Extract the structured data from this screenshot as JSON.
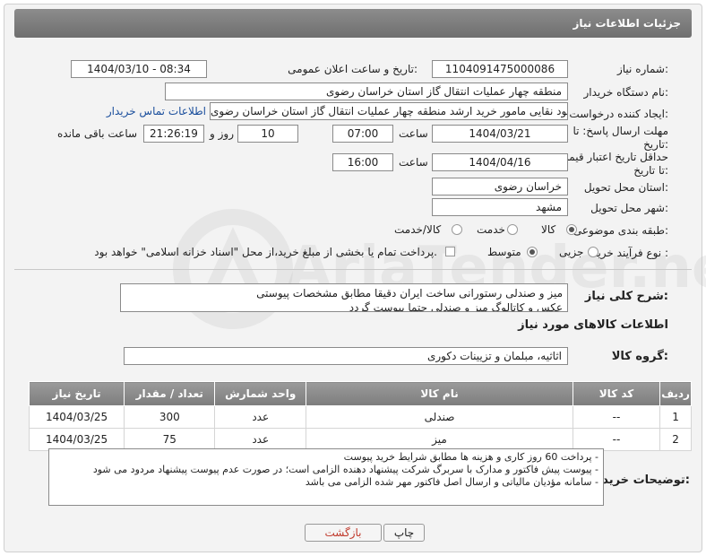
{
  "header": {
    "title": "جزئیات اطلاعات نیاز"
  },
  "fields": {
    "need_number_label": "شماره نیاز:",
    "need_number": "1104091475000086",
    "announce_label": "تاریخ و ساعت اعلان عمومی:",
    "announce_value": "1404/03/10 - 08:34",
    "buyer_org_label": "نام دستگاه خریدار:",
    "buyer_org": "منطقه چهار عملیات انتقال گاز    استان خراسان رضوی",
    "requester_label": "ایجاد کننده درخواست:",
    "requester": "محمود نقایی مامور خرید ارشد منطقه چهار عملیات انتقال گاز    استان خراسان رضوی",
    "contact_link": "اطلاعات تماس خریدار",
    "deadline_label": "مهلت ارسال پاسخ: تا تاریخ:",
    "deadline_date": "1404/03/21",
    "time_label": "ساعت",
    "deadline_time": "07:00",
    "days_value": "10",
    "days_label": "روز و",
    "remaining_time": "21:26:19",
    "remaining_label": "ساعت باقی مانده",
    "validity_label": "حداقل تاریخ اعتبار قیمت: تا تاریخ:",
    "validity_date": "1404/04/16",
    "validity_time": "16:00",
    "province_label": "استان محل تحویل:",
    "province": "خراسان رضوی",
    "city_label": "شهر محل تحویل:",
    "city": "مشهد",
    "category_label": "طبقه بندی موضوعی:",
    "category_options": [
      "کالا",
      "خدمت",
      "کالا/خدمت"
    ],
    "process_label": "نوع فرآیند خرید :",
    "process_options": [
      "جزیی",
      "متوسط"
    ],
    "payment_note": "پرداخت تمام یا بخشی از مبلغ خرید،از محل \"اسناد خزانه اسلامی\" خواهد بود."
  },
  "description": {
    "label": "شرح کلی نیاز:",
    "line1": "میز و صندلی رستورانی ساخت ایران دقیقا مطابق مشخصات پیوستی",
    "line2": "عکس و کاتالوگ میز و صندلی حتما پیوست گردد"
  },
  "goods_section": {
    "title": "اطلاعات کالاهای مورد نیاز",
    "group_label": "گروه کالا:",
    "group_value": "اثاثیه، مبلمان و تزیینات دکوری"
  },
  "table": {
    "headers": [
      "ردیف",
      "کد کالا",
      "نام کالا",
      "واحد شمارش",
      "تعداد / مقدار",
      "تاریخ نیاز"
    ],
    "rows": [
      [
        "1",
        "--",
        "صندلی",
        "عدد",
        "300",
        "1404/03/25"
      ],
      [
        "2",
        "--",
        "میز",
        "عدد",
        "75",
        "1404/03/25"
      ]
    ]
  },
  "buyer_notes": {
    "label": "توضیحات خریدار:",
    "line1": "- پرداخت 60 روز کاری و هزینه ها مطابق شرایط خرید پیوست",
    "line2": "- پیوست پیش فاکتور و مدارک با سربرگ شرکت پیشنهاد دهنده الزامی است؛ در صورت عدم پیوست پیشنهاد مردود می شود",
    "line3": "- سامانه مؤدیان مالیاتی و ارسال اصل فاکتور مهر شده  الزامی می باشد"
  },
  "buttons": {
    "print": "چاپ",
    "back": "بازگشت"
  },
  "watermark": "AriaTender.net",
  "colors": {
    "header_bg": "#7d7d7d",
    "link": "#1a4e9c",
    "back_button_text": "#c0392b"
  }
}
